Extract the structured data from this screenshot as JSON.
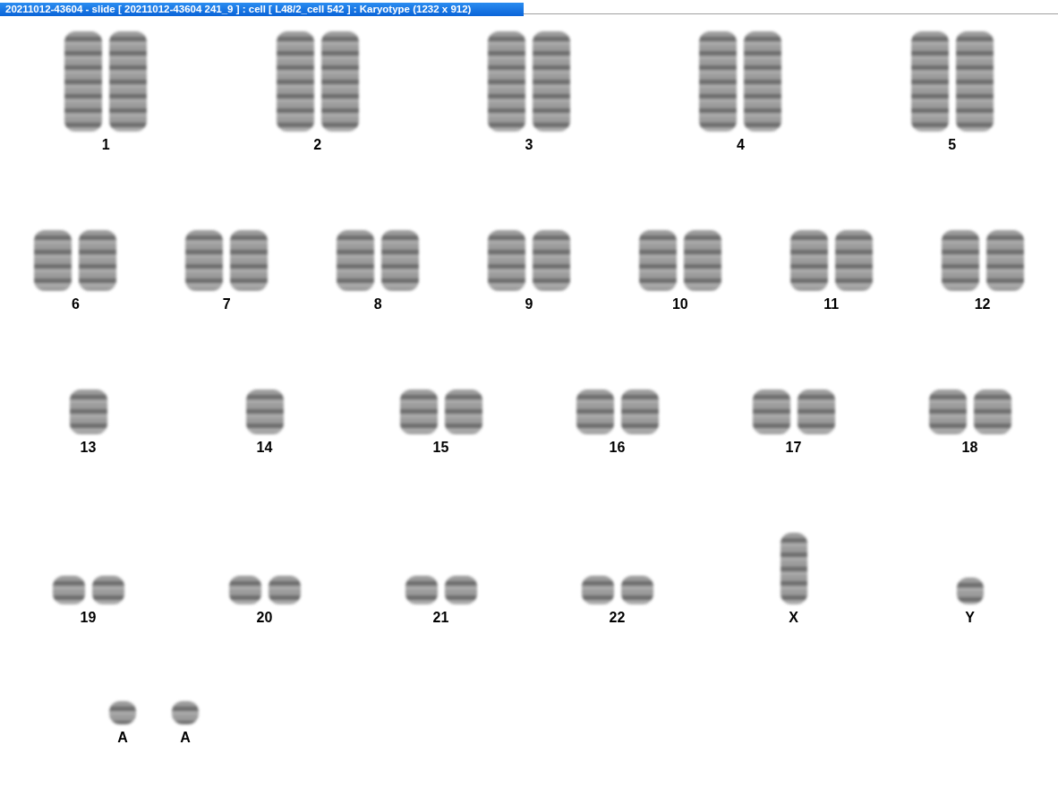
{
  "window": {
    "title": "20211012-43604 - slide [ 20211012-43604 241_9 ] : cell [ L48/2_cell 542 ] : Karyotype  (1232 x 912)"
  },
  "karyotype": {
    "rows": [
      [
        {
          "label": "1",
          "kind": "pair"
        },
        {
          "label": "2",
          "kind": "pair"
        },
        {
          "label": "3",
          "kind": "pair"
        },
        {
          "label": "4",
          "kind": "pair"
        },
        {
          "label": "5",
          "kind": "pair"
        }
      ],
      [
        {
          "label": "6",
          "kind": "pair"
        },
        {
          "label": "7",
          "kind": "pair"
        },
        {
          "label": "8",
          "kind": "pair"
        },
        {
          "label": "9",
          "kind": "pair"
        },
        {
          "label": "10",
          "kind": "pair"
        },
        {
          "label": "11",
          "kind": "pair"
        },
        {
          "label": "12",
          "kind": "pair"
        }
      ],
      [
        {
          "label": "13",
          "kind": "single"
        },
        {
          "label": "14",
          "kind": "single"
        },
        {
          "label": "15",
          "kind": "pair"
        },
        {
          "label": "16",
          "kind": "pair"
        },
        {
          "label": "17",
          "kind": "pair"
        },
        {
          "label": "18",
          "kind": "pair"
        }
      ],
      [
        {
          "label": "19",
          "kind": "pair"
        },
        {
          "label": "20",
          "kind": "pair"
        },
        {
          "label": "21",
          "kind": "pair"
        },
        {
          "label": "22",
          "kind": "pair"
        },
        {
          "label": "X",
          "kind": "single"
        },
        {
          "label": "Y",
          "kind": "single"
        }
      ],
      [
        {
          "label": "A",
          "kind": "single"
        },
        {
          "label": "A",
          "kind": "single"
        }
      ]
    ]
  }
}
